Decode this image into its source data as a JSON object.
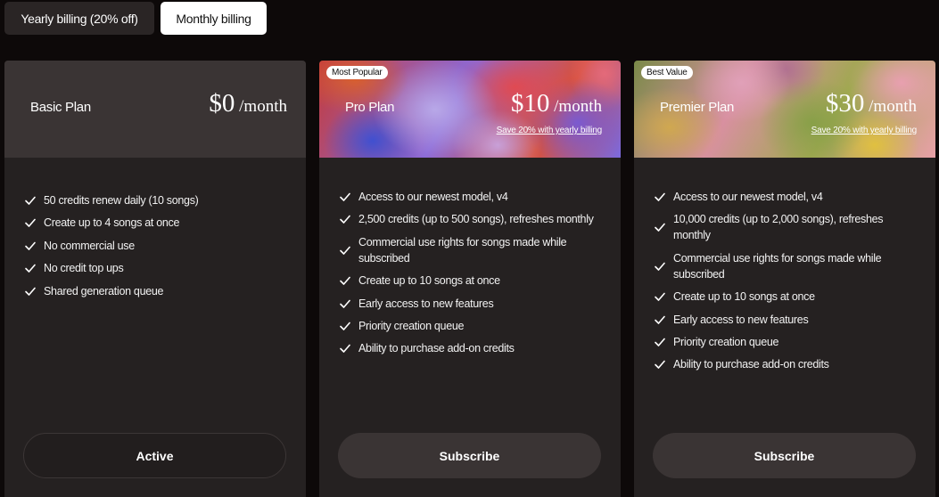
{
  "billing": {
    "yearly_label": "Yearly billing (20% off)",
    "monthly_label": "Monthly billing",
    "selected": "monthly"
  },
  "plans": [
    {
      "badge": "",
      "name": "Basic Plan",
      "price_amount": "$0",
      "price_period": " /month",
      "save_text": "",
      "features": [
        "50 credits renew daily (10 songs)",
        "Create up to 4 songs at once",
        "No commercial use",
        "No credit top ups",
        "Shared generation queue"
      ],
      "button_label": "Active"
    },
    {
      "badge": "Most Popular",
      "name": "Pro Plan",
      "price_amount": "$10",
      "price_period": " /month",
      "save_text": "Save 20% with yearly billing",
      "features": [
        "Access to our newest model, v4",
        "2,500 credits (up to 500 songs), refreshes monthly",
        "Commercial use rights for songs made while subscribed",
        "Create up to 10 songs at once",
        "Early access to new features",
        "Priority creation queue",
        "Ability to purchase add-on credits"
      ],
      "button_label": "Subscribe"
    },
    {
      "badge": "Best Value",
      "name": "Premier Plan",
      "price_amount": "$30",
      "price_period": " /month",
      "save_text": "Save 20% with yearly billing",
      "features": [
        "Access to our newest model, v4",
        "10,000 credits (up to 2,000 songs), refreshes monthly",
        "Commercial use rights for songs made while subscribed",
        "Create up to 10 songs at once",
        "Early access to new features",
        "Priority creation queue",
        "Ability to purchase add-on credits"
      ],
      "button_label": "Subscribe"
    }
  ],
  "icons": {
    "feature_bullet": "check-icon"
  },
  "colors": {
    "page_bg": "#0d0909",
    "card_bg": "#252121",
    "basic_header_bg": "#3a3434",
    "toggle_selected_bg": "#ffffff",
    "toggle_unselected_bg": "#2a2525",
    "subscribe_button_bg": "#3a3434"
  }
}
